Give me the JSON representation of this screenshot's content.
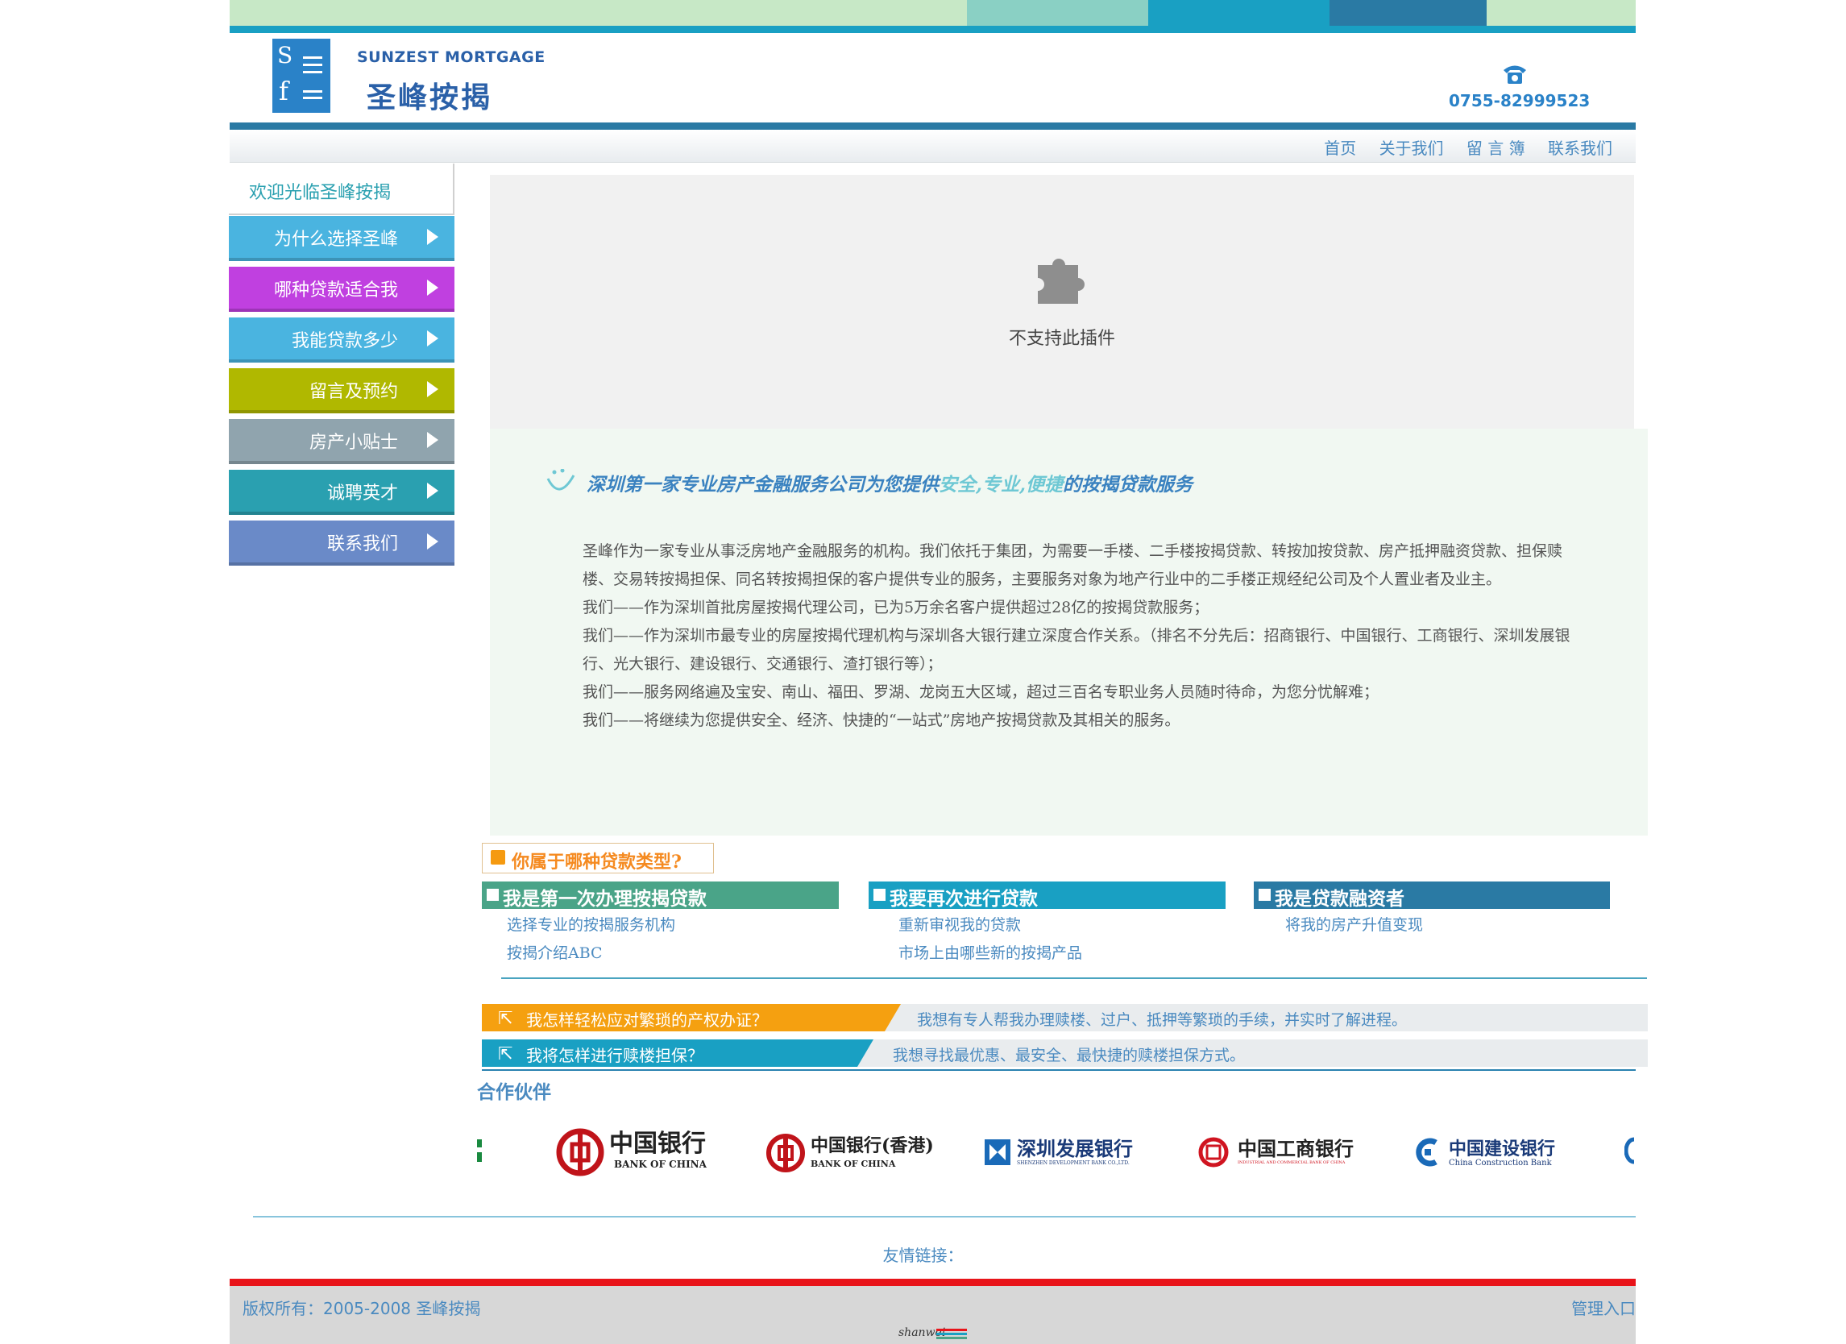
{
  "header": {
    "brand_en": "SUNZEST MORTGAGE",
    "brand_cn": "圣峰按揭",
    "logo_s": "S",
    "logo_f": "f",
    "phone": "0755-82999523"
  },
  "nav": [
    "首页",
    "关于我们",
    "留 言 簿",
    "联系我们"
  ],
  "sidebar": {
    "welcome": "欢迎光临圣峰按揭",
    "items": [
      {
        "label": "为什么选择圣峰",
        "color": "#4ab4e0"
      },
      {
        "label": "哪种贷款适合我",
        "color": "#c040e0"
      },
      {
        "label": "我能贷款多少",
        "color": "#4ab4e0"
      },
      {
        "label": "留言及预约",
        "color": "#b0b800"
      },
      {
        "label": "房产小贴士",
        "color": "#90a4ae"
      },
      {
        "label": "诚聘英才",
        "color": "#2aa0b0"
      },
      {
        "label": "联系我们",
        "color": "#6a8ac8"
      }
    ]
  },
  "plugin": {
    "message": "不支持此插件"
  },
  "intro": {
    "title_a": "深圳第一家专业房产金融服务公司为您提供",
    "title_hl": "安全,专业,便捷",
    "title_b": "的按揭贷款服务",
    "paragraphs": [
      "圣峰作为一家专业从事泛房地产金融服务的机构。我们依托于集团，为需要一手楼、二手楼按揭贷款、转按加按贷款、房产抵押融资贷款、担保赎楼、交易转按揭担保、同名转按揭担保的客户提供专业的服务，主要服务对象为地产行业中的二手楼正规经纪公司及个人置业者及业主。",
      "我们——作为深圳首批房屋按揭代理公司，已为5万余名客户提供超过28亿的按揭贷款服务；",
      "我们——作为深圳市最专业的房屋按揭代理机构与深圳各大银行建立深度合作关系。（排名不分先后：招商银行、中国银行、工商银行、深圳发展银行、光大银行、建设银行、交通银行、渣打银行等）；",
      "我们——服务网络遍及宝安、南山、福田、罗湖、龙岗五大区域，超过三百名专职业务人员随时待命，为您分忧解难；",
      "我们——将继续为您提供安全、经济、快捷的“一站式”房地产按揭贷款及其相关的服务。"
    ]
  },
  "loan_types": {
    "heading": "你属于哪种贷款类型?",
    "categories": [
      {
        "title": "我是第一次办理按揭贷款",
        "color": "#4aa488",
        "links": [
          "选择专业的按揭服务机构",
          "按揭介绍ABC"
        ]
      },
      {
        "title": "我要再次进行贷款",
        "color": "#19a0c3",
        "links": [
          "重新审视我的贷款",
          "市场上由哪些新的按揭产品"
        ]
      },
      {
        "title": "我是贷款融资者",
        "color": "#2a7aa4",
        "links": [
          "将我的房产升值变现"
        ]
      }
    ]
  },
  "banners": [
    {
      "title": "我怎样轻松应对繁琐的产权办证？",
      "desc": "我想有专人帮我办理赎楼、过户、抵押等繁琐的手续，并实时了解进程。",
      "color": "#f5a010"
    },
    {
      "title": "我将怎样进行赎楼担保？",
      "desc": "我想寻找最优惠、最安全、最快捷的赎楼担保方式。",
      "color": "#19a0c3"
    }
  ],
  "partners": {
    "title": "合作伙伴",
    "logos": [
      {
        "cn": "中国银行",
        "en": "BANK OF CHINA"
      },
      {
        "cn": "中国银行(香港)",
        "en": "BANK OF CHINA"
      },
      {
        "cn": "深圳发展银行",
        "en": "SHENZHEN DEVELOPMENT BANK CO.,LTD."
      },
      {
        "cn": "中国工商银行",
        "en": "INDUSTRIAL AND COMMERCIAL BANK OF CHINA"
      },
      {
        "cn": "中国建设银行",
        "en": "China Construction Bank"
      }
    ]
  },
  "friends_label": "友情链接：",
  "footer": {
    "copyright_label": "版权所有：",
    "years": "2005-2008",
    "company": "圣峰按揭",
    "admin": "管理入口",
    "credit": "shanwei"
  }
}
